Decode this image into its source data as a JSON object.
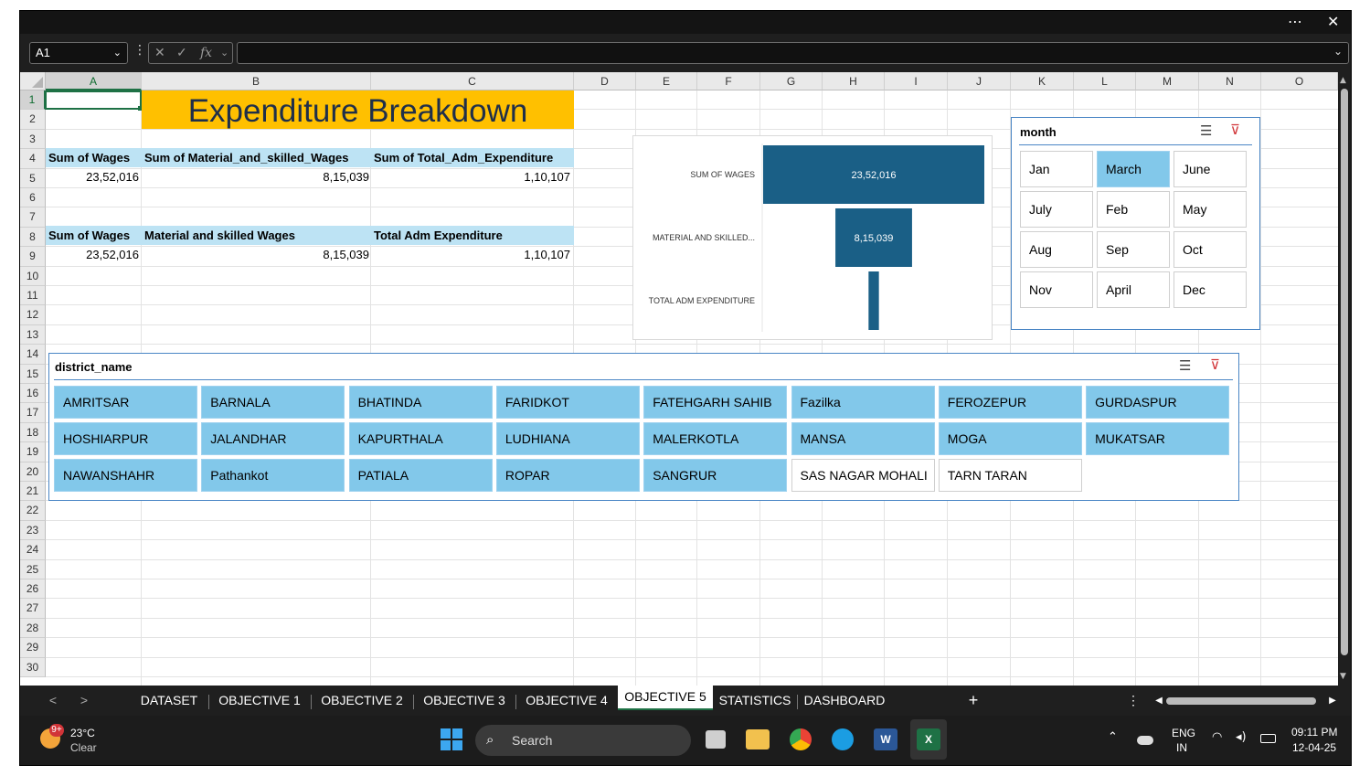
{
  "window": {
    "more": "⋯",
    "close": "✕"
  },
  "formula_bar": {
    "name_box": "A1",
    "fx": "fx",
    "cancel": "✕",
    "enter": "✓",
    "value": ""
  },
  "columns": [
    "A",
    "B",
    "C",
    "D",
    "E",
    "F",
    "G",
    "H",
    "I",
    "J",
    "K",
    "L",
    "M",
    "N",
    "O"
  ],
  "rows": [
    "1",
    "2",
    "3",
    "4",
    "5",
    "6",
    "7",
    "8",
    "9",
    "10",
    "11",
    "12",
    "13",
    "14",
    "15",
    "16",
    "17",
    "18",
    "19",
    "20",
    "21",
    "22",
    "23",
    "24",
    "25",
    "26",
    "27",
    "28",
    "29",
    "30"
  ],
  "sheet": {
    "title": "Expenditure Breakdown",
    "title_color": "#ffc000",
    "header_fill": "#bde3f4",
    "table1": {
      "headers": [
        "Sum of Wages",
        "Sum of Material_and_skilled_Wages",
        "Sum of Total_Adm_Expenditure"
      ],
      "values": [
        "23,52,016",
        "8,15,039",
        "1,10,107"
      ]
    },
    "table2": {
      "headers": [
        "Sum of Wages",
        "Material and skilled Wages",
        "Total Adm Expenditure"
      ],
      "values": [
        "23,52,016",
        "8,15,039",
        "1,10,107"
      ]
    }
  },
  "chart_data": {
    "type": "bar",
    "subtype": "funnel",
    "categories": [
      "SUM OF WAGES",
      "MATERIAL AND SKILLED...",
      "TOTAL ADM EXPENDITURE"
    ],
    "values": [
      2352016,
      815039,
      110107
    ],
    "data_labels": [
      "23,52,016",
      "8,15,039",
      ""
    ],
    "bar_color": "#1a5f86",
    "grid": false,
    "legend": "none"
  },
  "month_slicer": {
    "title": "month",
    "items": [
      {
        "label": "Jan",
        "selected": false
      },
      {
        "label": "March",
        "selected": true
      },
      {
        "label": "June",
        "selected": false
      },
      {
        "label": "July",
        "selected": false
      },
      {
        "label": "Feb",
        "selected": false
      },
      {
        "label": "May",
        "selected": false
      },
      {
        "label": "Aug",
        "selected": false
      },
      {
        "label": "Sep",
        "selected": false
      },
      {
        "label": "Oct",
        "selected": false
      },
      {
        "label": "Nov",
        "selected": false
      },
      {
        "label": "April",
        "selected": false
      },
      {
        "label": "Dec",
        "selected": false
      }
    ]
  },
  "district_slicer": {
    "title": "district_name",
    "items": [
      {
        "label": "AMRITSAR",
        "selected": true
      },
      {
        "label": "BARNALA",
        "selected": true
      },
      {
        "label": "BHATINDA",
        "selected": true
      },
      {
        "label": "FARIDKOT",
        "selected": true
      },
      {
        "label": "FATEHGARH SAHIB",
        "selected": true
      },
      {
        "label": "Fazilka",
        "selected": true
      },
      {
        "label": "FEROZEPUR",
        "selected": true
      },
      {
        "label": "GURDASPUR",
        "selected": true
      },
      {
        "label": "HOSHIARPUR",
        "selected": true
      },
      {
        "label": "JALANDHAR",
        "selected": true
      },
      {
        "label": "KAPURTHALA",
        "selected": true
      },
      {
        "label": "LUDHIANA",
        "selected": true
      },
      {
        "label": "MALERKOTLA",
        "selected": true
      },
      {
        "label": "MANSA",
        "selected": true
      },
      {
        "label": "MOGA",
        "selected": true
      },
      {
        "label": "MUKATSAR",
        "selected": true
      },
      {
        "label": "NAWANSHAHR",
        "selected": true
      },
      {
        "label": "Pathankot",
        "selected": true
      },
      {
        "label": "PATIALA",
        "selected": true
      },
      {
        "label": "ROPAR",
        "selected": true
      },
      {
        "label": "SANGRUR",
        "selected": true
      },
      {
        "label": "SAS NAGAR MOHALI",
        "selected": false
      },
      {
        "label": "TARN TARAN",
        "selected": false
      }
    ]
  },
  "sheet_tabs": {
    "nav_prev": "<",
    "nav_next": ">",
    "tabs": [
      "DATASET",
      "OBJECTIVE 1",
      "OBJECTIVE 2",
      "OBJECTIVE 3",
      "OBJECTIVE 4",
      "OBJECTIVE 5",
      "STATISTICS",
      "DASHBOARD"
    ],
    "active": "OBJECTIVE 5",
    "add": "+",
    "more": "⋮"
  },
  "taskbar": {
    "weather_badge": "9+",
    "temp": "23°C",
    "condition": "Clear",
    "search": "Search",
    "lang": "ENG",
    "region": "IN",
    "time": "09:11 PM",
    "date": "12-04-25"
  }
}
